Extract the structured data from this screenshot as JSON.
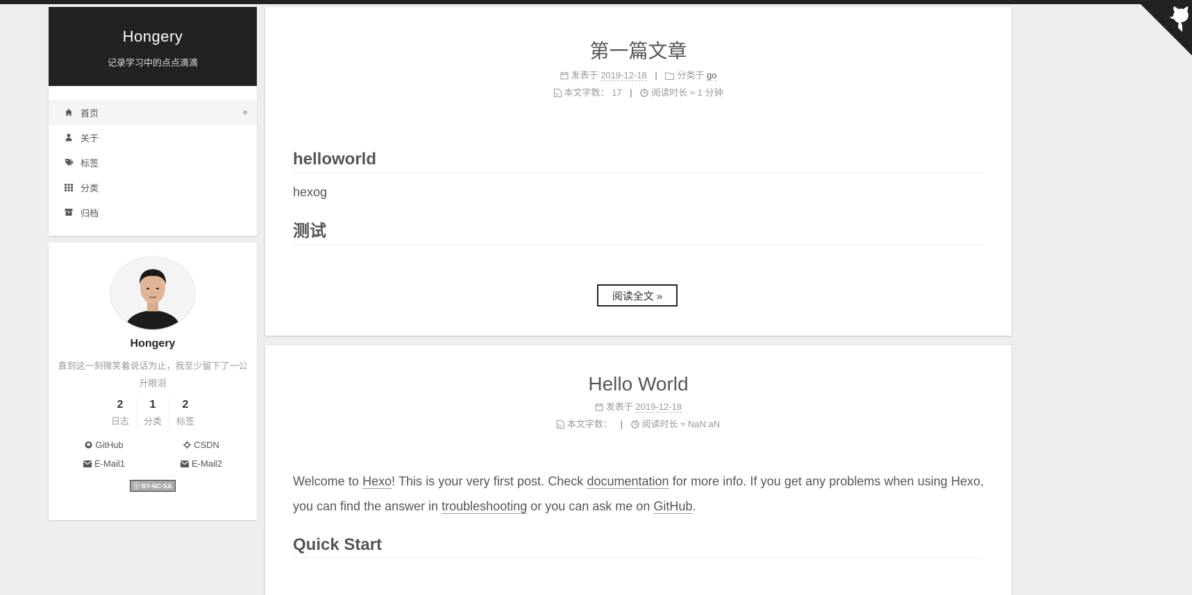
{
  "site": {
    "title": "Hongery",
    "subtitle": "记录学习中的点点滴滴"
  },
  "menu": [
    {
      "label": "首页",
      "icon": "home-icon",
      "active": true
    },
    {
      "label": "关于",
      "icon": "user-icon"
    },
    {
      "label": "标签",
      "icon": "tags-icon"
    },
    {
      "label": "分类",
      "icon": "grid-icon"
    },
    {
      "label": "归档",
      "icon": "archive-icon"
    }
  ],
  "profile": {
    "name": "Hongery",
    "description": "直到这一刻微笑着说话为止，我至少留下了一公升眼泪",
    "stats": [
      {
        "num": "2",
        "label": "日志"
      },
      {
        "num": "1",
        "label": "分类"
      },
      {
        "num": "2",
        "label": "标签"
      }
    ],
    "links": [
      {
        "label": "GitHub",
        "icon": "github-icon"
      },
      {
        "label": "CSDN",
        "icon": "crosshairs-icon"
      },
      {
        "label": "E-Mail1",
        "icon": "envelope-icon"
      },
      {
        "label": "E-Mail2",
        "icon": "envelope-icon"
      }
    ],
    "license": "BY-NC-SA"
  },
  "posts": [
    {
      "title": "第一篇文章",
      "posted_label": "发表于",
      "date": "2019-12-18",
      "category_label": "分类于",
      "category": "go",
      "wordcount_label": "本文字数：",
      "wordcount": "17",
      "readtime_label": "阅读时长 ≈",
      "readtime": "1 分钟",
      "heading1": "helloworld",
      "paragraph1": "hexog",
      "heading2": "测试",
      "read_more": "阅读全文 »"
    },
    {
      "title": "Hello World",
      "posted_label": "发表于",
      "date": "2019-12-18",
      "wordcount_label": "本文字数：",
      "readtime_label": "阅读时长 ≈",
      "readtime": "NaN:aN",
      "p_a": "Welcome to ",
      "link_hexo": "Hexo",
      "p_b": "! This is your very first post. Check ",
      "link_docs": "documentation",
      "p_c": " for more info. If you get any problems when using Hexo, you can find the answer in ",
      "link_trouble": "troubleshooting",
      "p_d": " or you can ask me on ",
      "link_github": "GitHub",
      "p_e": ".",
      "heading1": "Quick Start"
    }
  ],
  "colors": {
    "dark": "#222222",
    "background": "#eeeeee"
  }
}
